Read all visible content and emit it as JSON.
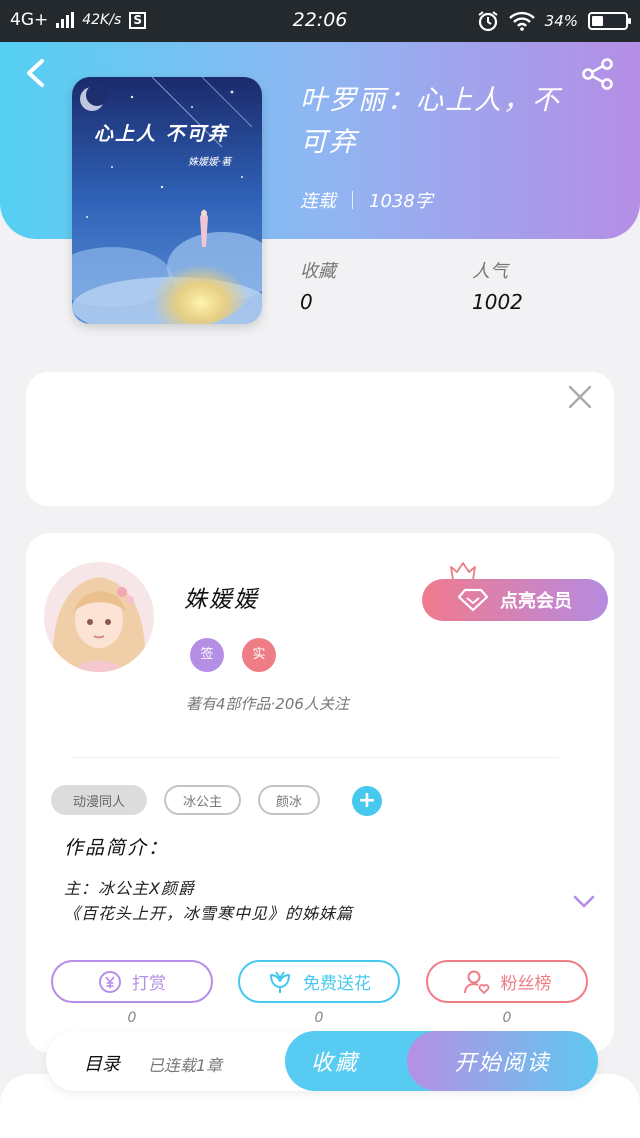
{
  "status_bar": {
    "network": "4G+",
    "speed": "42K/s",
    "s_badge": "S",
    "time": "22:06",
    "battery": "34%",
    "battery_level": 0.34
  },
  "book": {
    "cover_title": "心上人 不可弃",
    "cover_author": "姝媛媛·著",
    "title": "叶罗丽：心上人，不可弃",
    "status": "连载",
    "word_count": "1038字",
    "favorites_label": "收藏",
    "favorites_value": "0",
    "popularity_label": "人气",
    "popularity_value": "1002"
  },
  "author": {
    "name": "姝媛媛",
    "badge_sign": "签",
    "badge_real": "实",
    "stats": "著有4部作品·206人关注",
    "vip_button": "点亮会员"
  },
  "tags": [
    "动漫同人",
    "冰公主",
    "颜冰"
  ],
  "intro": {
    "title": "作品简介：",
    "lines": [
      "主：冰公主X颜爵",
      "《百花头上开，冰雪寒中见》的姊妹篇"
    ]
  },
  "actions": [
    {
      "label": "打赏",
      "count": "0",
      "color": "#b58ee6"
    },
    {
      "label": "免费送花",
      "count": "0",
      "color": "#47c8ee"
    },
    {
      "label": "粉丝榜",
      "count": "0",
      "color": "#ee7d86"
    }
  ],
  "bottom_bar": {
    "catalog": "目录",
    "progress": "已连载1章",
    "favorite": "收藏",
    "read": "开始阅读"
  },
  "colors": {
    "header_gradient_start": "#55d0f2",
    "header_gradient_end": "#b58ee6",
    "accent_blue": "#47c8ee",
    "accent_purple": "#b58ee6",
    "accent_pink": "#ee7d86"
  }
}
